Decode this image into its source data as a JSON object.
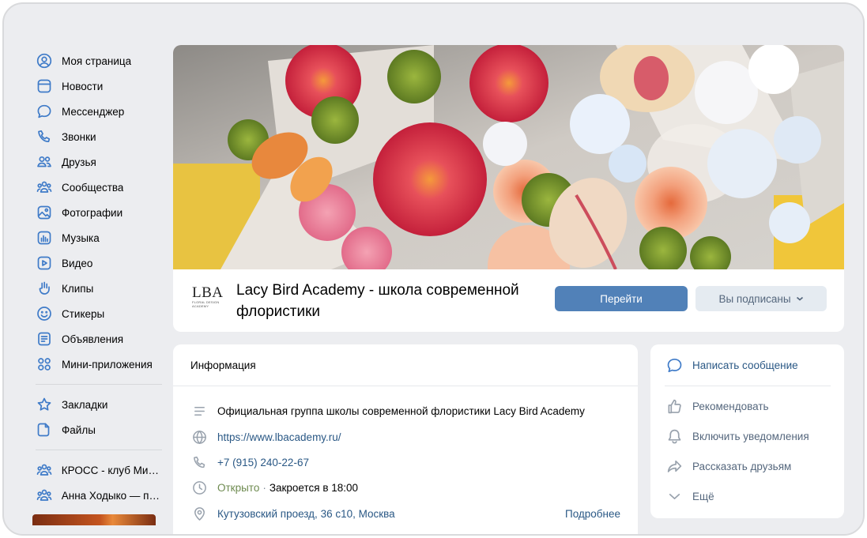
{
  "sidebar": {
    "items": [
      {
        "label": "Моя страница",
        "icon": "user-circle-icon"
      },
      {
        "label": "Новости",
        "icon": "news-icon"
      },
      {
        "label": "Мессенджер",
        "icon": "chat-bubble-icon"
      },
      {
        "label": "Звонки",
        "icon": "phone-icon"
      },
      {
        "label": "Друзья",
        "icon": "friends-icon"
      },
      {
        "label": "Сообщества",
        "icon": "communities-icon"
      },
      {
        "label": "Фотографии",
        "icon": "photo-icon"
      },
      {
        "label": "Музыка",
        "icon": "music-icon"
      },
      {
        "label": "Видео",
        "icon": "video-icon"
      },
      {
        "label": "Клипы",
        "icon": "clips-icon"
      },
      {
        "label": "Стикеры",
        "icon": "sticker-icon"
      },
      {
        "label": "Объявления",
        "icon": "classifieds-icon"
      },
      {
        "label": "Мини-приложения",
        "icon": "apps-grid-icon"
      }
    ],
    "secondary": [
      {
        "label": "Закладки",
        "icon": "star-icon"
      },
      {
        "label": "Файлы",
        "icon": "file-icon"
      }
    ],
    "groups": [
      {
        "label": "КРОСС - клуб Мин...",
        "icon": "communities-icon"
      },
      {
        "label": "Анна Ходыко — пс...",
        "icon": "communities-icon"
      }
    ]
  },
  "group": {
    "logo_text": "LBA",
    "logo_subtext": "FLORAL DESIGN ACADEMY",
    "name": "Lacy Bird Academy - школа современной флористики",
    "go_button": "Перейти",
    "subscribed_button": "Вы подписаны"
  },
  "info": {
    "title": "Информация",
    "description": "Официальная группа школы современной флористики Lacy Bird Academy",
    "website": "https://www.lbacademy.ru/",
    "phone": "+7 (915) 240-22-67",
    "open_status": "Открыто",
    "hours": "Закроется в 18:00",
    "address": "Кутузовский проезд, 36 с10, Москва",
    "more_link": "Подробнее"
  },
  "actions": {
    "message": "Написать сообщение",
    "recommend": "Рекомендовать",
    "notifications": "Включить уведомления",
    "share": "Рассказать друзьям",
    "more": "Ещё"
  },
  "colors": {
    "accent": "#5181b8",
    "link": "#2a5885",
    "icon_blue": "#3f7bc8",
    "background": "#ecedf0",
    "open_green": "#6d8a4f"
  }
}
